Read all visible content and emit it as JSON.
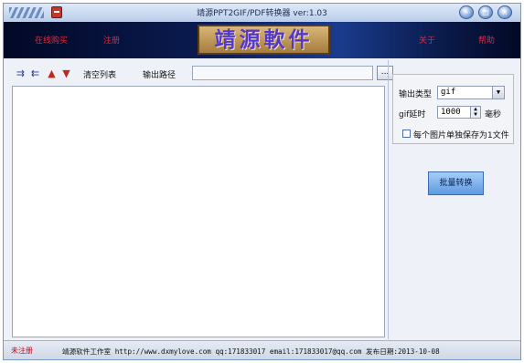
{
  "window": {
    "title": "靖源PPT2GIF/PDF转换器 ver:1.03"
  },
  "banner": {
    "buy_link": "在线购买",
    "register_link": "注册",
    "logo_text": "靖源軟件",
    "about_link": "关于",
    "help_link": "帮助",
    "accent_color": "#e8263a"
  },
  "toolbar": {
    "icons": [
      "add-file-icon",
      "remove-file-icon",
      "move-up-icon",
      "move-down-icon"
    ],
    "clear_list_label": "清空列表",
    "output_path_label": "输出路径",
    "output_path_value": "",
    "browse_label": "..."
  },
  "settings": {
    "output_type_label": "输出类型",
    "output_type_value": "gif",
    "gif_delay_label": "gif延时",
    "gif_delay_value": "1000",
    "gif_delay_unit": "毫秒",
    "single_file_label": "每个图片单独保存为1文件",
    "single_file_checked": false
  },
  "actions": {
    "convert_label": "批量转换"
  },
  "status": {
    "registration": "未注册",
    "studio_info": "靖源软件工作室 http://www.dxmylove.com qq:171833017 email:171833017@qq.com 发布日期:2013-10-08",
    "registration_color": "#d0021b"
  }
}
